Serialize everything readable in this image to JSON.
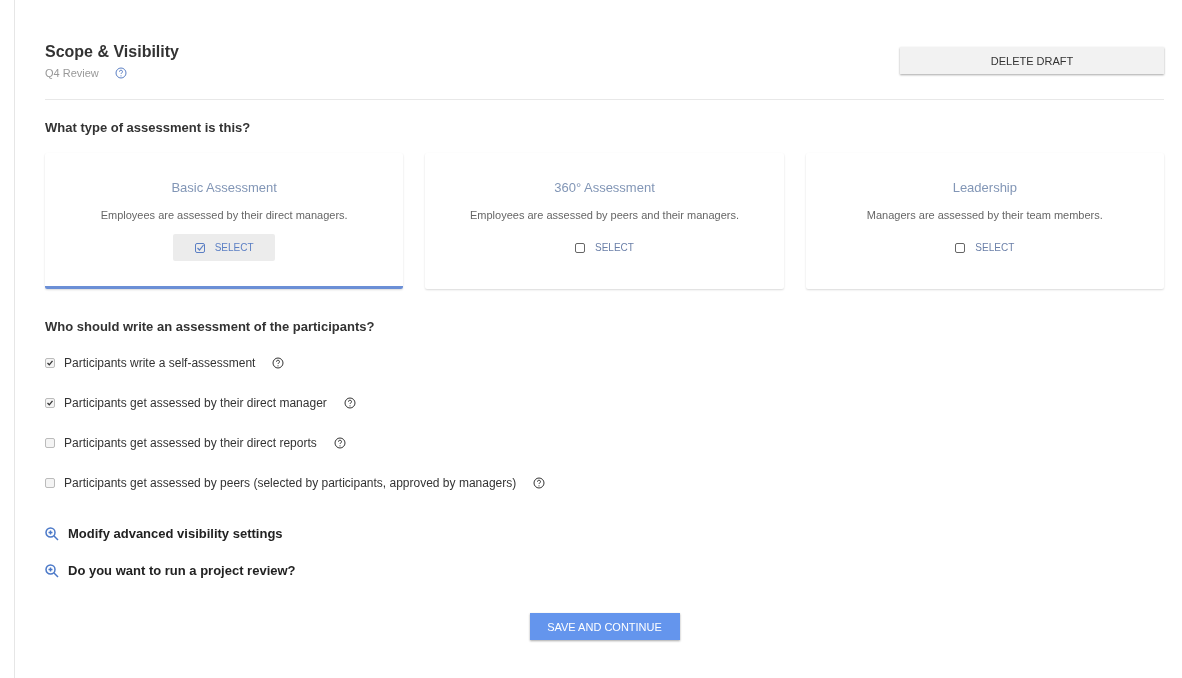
{
  "header": {
    "title": "Scope & Visibility",
    "subtitle": "Q4 Review",
    "delete_button": "DELETE DRAFT"
  },
  "assessment_type": {
    "question": "What type of assessment is this?",
    "options": [
      {
        "title": "Basic Assessment",
        "description": "Employees are assessed by their direct managers.",
        "button": "SELECT",
        "selected": true
      },
      {
        "title": "360° Assessment",
        "description": "Employees are assessed by peers and their managers.",
        "button": "SELECT",
        "selected": false
      },
      {
        "title": "Leadership",
        "description": "Managers are assessed by their team members.",
        "button": "SELECT",
        "selected": false
      }
    ]
  },
  "writers": {
    "question": "Who should write an assessment of the participants?",
    "options": [
      {
        "label": "Participants write a self-assessment",
        "checked": true
      },
      {
        "label": "Participants get assessed by their direct manager",
        "checked": true
      },
      {
        "label": "Participants get assessed by their direct reports",
        "checked": false
      },
      {
        "label": "Participants get assessed by peers (selected by participants, approved by managers)",
        "checked": false
      }
    ]
  },
  "expanders": [
    "Modify advanced visibility settings",
    "Do you want to run a project review?"
  ],
  "save_button": "SAVE AND CONTINUE"
}
